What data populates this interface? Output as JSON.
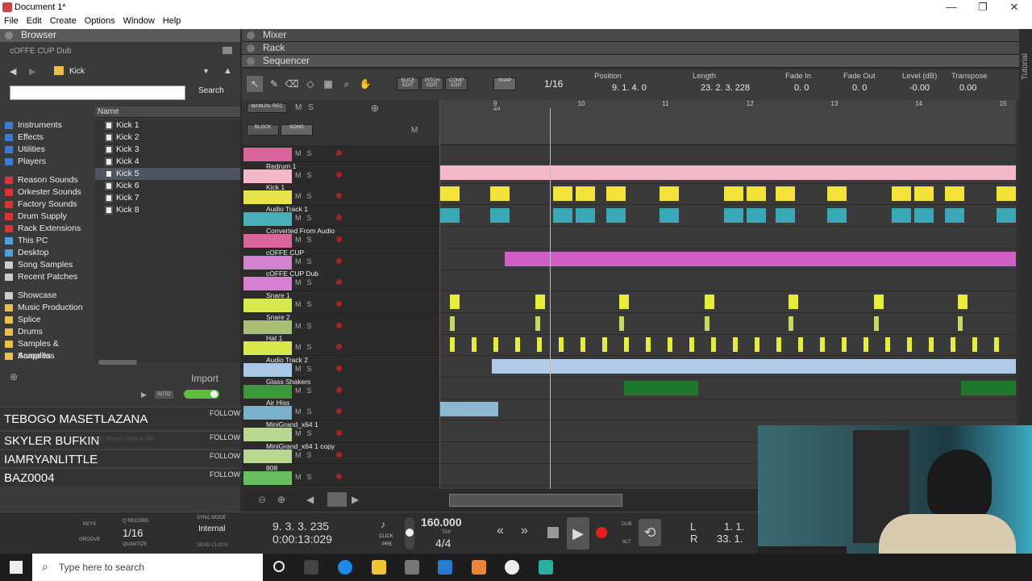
{
  "window": {
    "title": "Document 1*",
    "min": "—",
    "max": "❐",
    "close": "✕"
  },
  "menu": [
    "File",
    "Edit",
    "Create",
    "Options",
    "Window",
    "Help"
  ],
  "browser": {
    "header": "Browser",
    "subtitle": "cOFFE CUP  Dub",
    "folder": "Kick",
    "search_label": "Search",
    "search_value": "",
    "column_name": "Name",
    "left_items": [
      {
        "label": "Instruments",
        "color": "#3a7bd5"
      },
      {
        "label": "Effects",
        "color": "#3a7bd5"
      },
      {
        "label": "Utilities",
        "color": "#3a7bd5"
      },
      {
        "label": "Players",
        "color": "#3a7bd5"
      },
      {
        "label": "Reason Sounds",
        "color": "#d33"
      },
      {
        "label": "Orkester Sounds",
        "color": "#d33"
      },
      {
        "label": "Factory Sounds",
        "color": "#d33"
      },
      {
        "label": "Drum Supply",
        "color": "#d33"
      },
      {
        "label": "Rack Extensions",
        "color": "#d33"
      },
      {
        "label": "This PC",
        "color": "#4aa3e0"
      },
      {
        "label": "Desktop",
        "color": "#4aa3e0"
      },
      {
        "label": "Song Samples",
        "color": "#ccc"
      },
      {
        "label": "Recent Patches",
        "color": "#ccc"
      },
      {
        "label": "Showcase",
        "color": "#ccc"
      },
      {
        "label": "Music Production",
        "color": "#e8c04a"
      },
      {
        "label": "Splice",
        "color": "#e8c04a"
      },
      {
        "label": "Drums",
        "color": "#e8c04a"
      },
      {
        "label": "Samples & Acapellas",
        "color": "#e8c04a"
      },
      {
        "label": "Samples",
        "color": "#e8c04a"
      }
    ],
    "files": [
      "Kick 1",
      "Kick 2",
      "Kick 3",
      "Kick 4",
      "Kick 5",
      "Kick 6",
      "Kick 7",
      "Kick 8"
    ],
    "selected_file": "Kick 5",
    "import_label": "Import",
    "auto_label": "AUTO"
  },
  "follow_rows": [
    {
      "name": "TEBOGO MASETLAZANA",
      "action": "FOLLOW"
    },
    {
      "name": "SKYLER BUFKIN",
      "action": "FOLLOW",
      "note": "No tempo data in file"
    },
    {
      "name": "IAMRYANLITTLE",
      "action": "FOLLOW"
    },
    {
      "name": "BAZ0004",
      "action": "FOLLOW"
    }
  ],
  "sections": [
    "Mixer",
    "Rack",
    "Sequencer"
  ],
  "side_tab": "Tutorial",
  "toolbar": {
    "slice_edit": "SLICE EDIT",
    "pitch_edit": "PITCH EDIT",
    "comp_edit": "COMP EDIT",
    "snap": "SNAP",
    "snap_value": "1/16",
    "position_label": "Position",
    "position_value": "9.  1.  4.    0",
    "length_label": "Length",
    "length_value": "23.  2.  3. 228",
    "fadein_label": "Fade In",
    "fadein_value": "0.    0",
    "fadeout_label": "Fade Out",
    "fadeout_value": "0.    0",
    "level_label": "Level (dB)",
    "level_value": "-0.00",
    "transpose_label": "Transpose",
    "transpose_value": "0.00"
  },
  "seq_header": {
    "manual_rec": "MANUAL REC",
    "m": "M",
    "s": "S",
    "block": "BLOCK",
    "song": "SONG",
    "m2": "M"
  },
  "timeline": {
    "bars": [
      "9",
      "10",
      "11",
      "12",
      "13",
      "14",
      "15"
    ],
    "sig": "4/4"
  },
  "tracks": [
    {
      "name": "",
      "color": "#d9659a"
    },
    {
      "name": "Redrum 1",
      "color": "#f4b8c8"
    },
    {
      "name": "Kick 1",
      "color": "#e8e34a"
    },
    {
      "name": "Audio Track 1",
      "color": "#4ab0b8"
    },
    {
      "name": "Converted From Audio",
      "color": "#d9659a"
    },
    {
      "name": "cOFFE CUP",
      "color": "#d680d0"
    },
    {
      "name": "cOFFE CUP  Dub",
      "color": "#d680d0",
      "input": "IN"
    },
    {
      "name": "Snare 1",
      "color": "#d8e84a"
    },
    {
      "name": "Snare 2",
      "color": "#a8c070"
    },
    {
      "name": "Hat 1",
      "color": "#d8e84a"
    },
    {
      "name": "Audio Track 2",
      "color": "#a8c8e8"
    },
    {
      "name": "Glass Shakers",
      "color": "#3a9a3a"
    },
    {
      "name": "Air Hiss",
      "color": "#7ab0c8"
    },
    {
      "name": "MiniGrand_x64 1",
      "color": "#b8d890"
    },
    {
      "name": "MiniGrand_x64 1 copy",
      "color": "#b8d890"
    },
    {
      "name": "808",
      "color": "#6ac060"
    }
  ],
  "transport": {
    "keys": "KEYS",
    "groove": "GROOVE",
    "qrecord": "Q RECORD",
    "quantize_value": "1/16",
    "quantize": "QUANTIZE",
    "sync_mode": "SYNC MODE",
    "sync_value": "Internal",
    "send_clock": "SEND CLOCK",
    "bar_pos": "9.  3.  3. 235",
    "time_pos": "0:00:13:029",
    "click": "CLICK",
    "pre": "PRE",
    "tempo": "160.000",
    "tap": "TAP",
    "sig": "4/4",
    "dub": "DUB",
    "alt": "ALT",
    "l": "L",
    "r": "R",
    "l_val": "1.   1.",
    "r_val": "33.   1."
  },
  "taskbar": {
    "search_placeholder": "Type here to search"
  },
  "colors": {
    "accent": "#2a6aa8",
    "pink": "#f4b8c8",
    "yellow": "#f2e23a",
    "teal": "#3aa8b8",
    "magenta": "#d060c8"
  }
}
